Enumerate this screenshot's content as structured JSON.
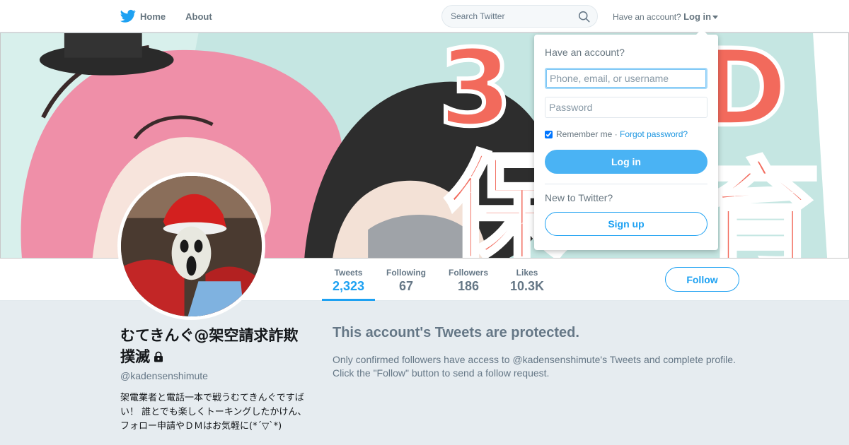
{
  "colors": {
    "accent": "#1da1f2",
    "text_secondary": "#657786",
    "page_bg": "#e6ecf0"
  },
  "nav": {
    "home_label": "Home",
    "about_label": "About",
    "search_placeholder": "Search Twitter",
    "have_account_text": "Have an account?",
    "login_label": "Log in"
  },
  "profile_nav": {
    "stats": [
      {
        "label": "Tweets",
        "value": "2,323"
      },
      {
        "label": "Following",
        "value": "67"
      },
      {
        "label": "Followers",
        "value": "186"
      },
      {
        "label": "Likes",
        "value": "10.3K"
      }
    ],
    "follow_label": "Follow"
  },
  "profile": {
    "name": "むてきんぐ@架空請求詐欺撲滅",
    "screen_name": "@kadensenshimute",
    "bio": "架電業者と電話一本で戦うむてきんぐですばい！ 誰とでも楽しくトーキングしたかけん、フォロー申請やＤＭはお気軽に(*´▽`*)"
  },
  "protected": {
    "title": "This account's Tweets are protected.",
    "message": "Only confirmed followers have access to @kadensenshimute's Tweets and complete profile. Click the \"Follow\" button to send a follow request."
  },
  "login_dropdown": {
    "title": "Have an account?",
    "username_placeholder": "Phone, email, or username",
    "password_placeholder": "Password",
    "remember_label": "Remember me",
    "separator": "·",
    "forgot_label": "Forgot password?",
    "login_button": "Log in",
    "new_label": "New to Twitter?",
    "signup_button": "Sign up"
  }
}
